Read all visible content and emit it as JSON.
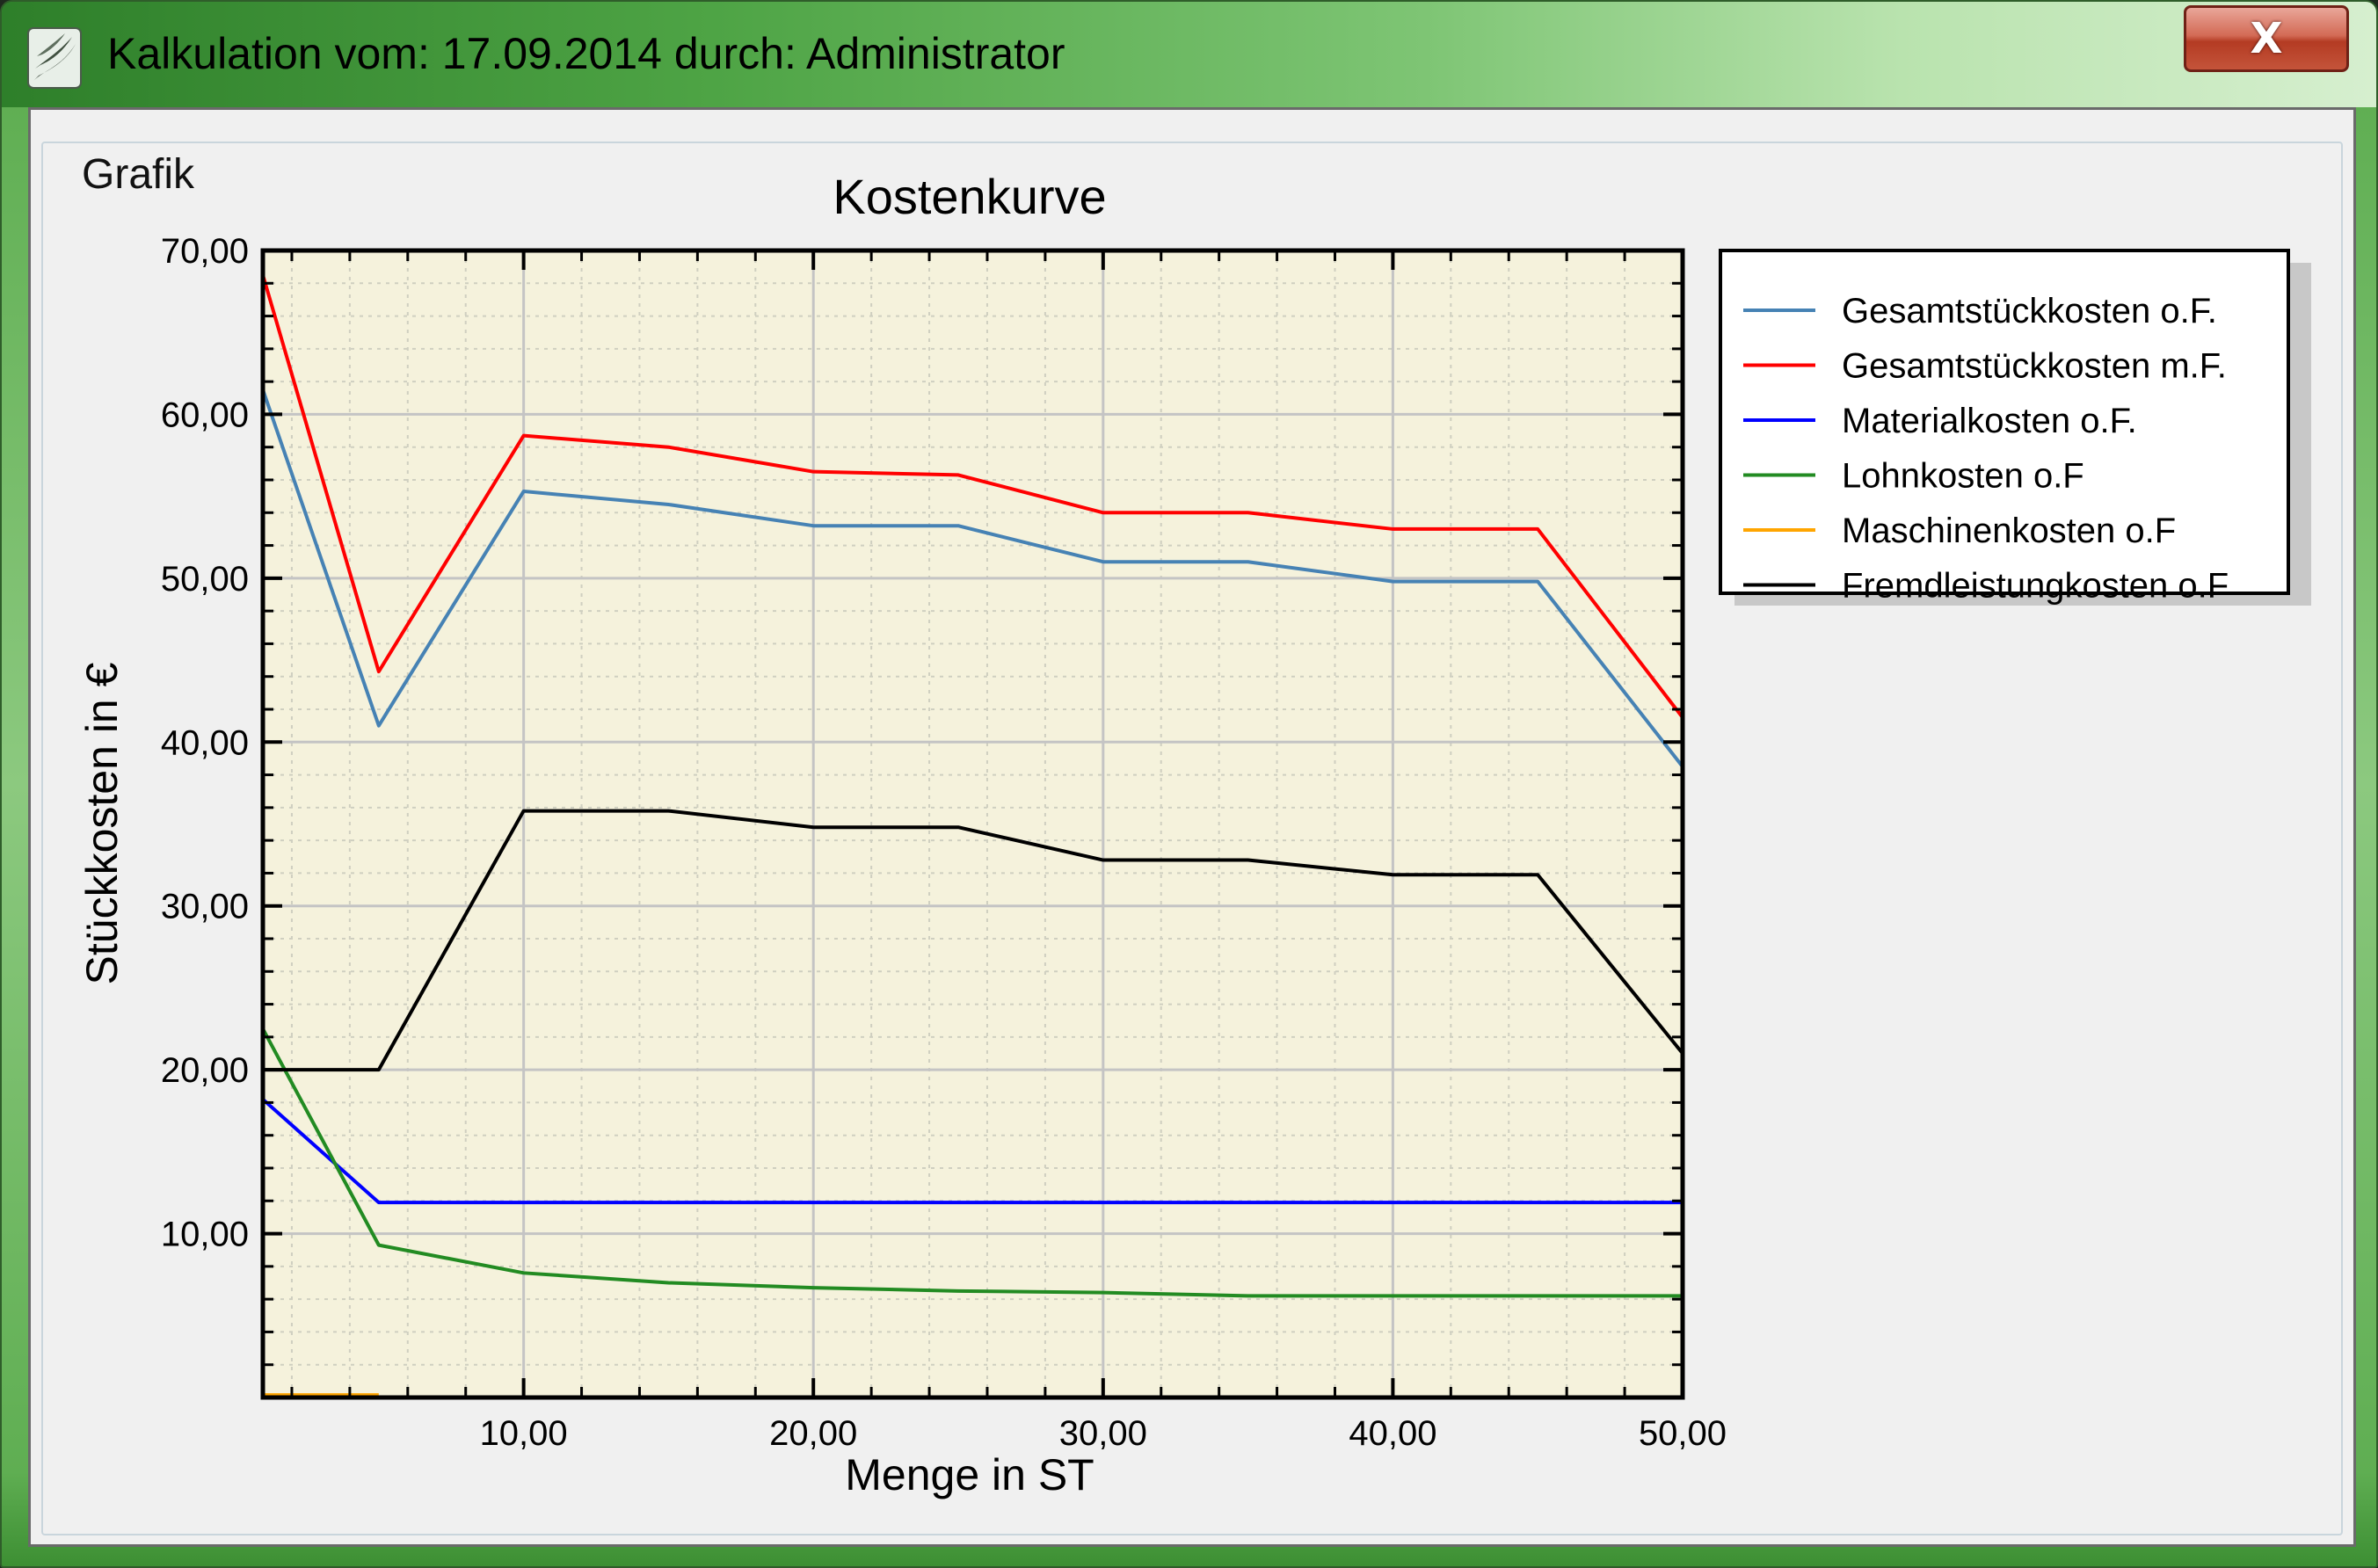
{
  "window": {
    "title": "Kalkulation vom: 17.09.2014 durch: Administrator",
    "close_label": "X",
    "icon": "app-logo-icon"
  },
  "groupbox": {
    "label": "Grafik"
  },
  "chart_data": {
    "type": "line",
    "title": "Kostenkurve",
    "xlabel": "Menge in ST",
    "ylabel": "Stückkosten in €",
    "xlim": [
      1,
      50
    ],
    "ylim": [
      0,
      70
    ],
    "x_ticks": [
      10,
      20,
      30,
      40,
      50
    ],
    "x_tick_labels": [
      "10,00",
      "20,00",
      "30,00",
      "40,00",
      "50,00"
    ],
    "y_ticks": [
      10,
      20,
      30,
      40,
      50,
      60,
      70
    ],
    "y_tick_labels": [
      "10,00",
      "20,00",
      "30,00",
      "40,00",
      "50,00",
      "60,00",
      "70,00"
    ],
    "grid": true,
    "legend_position": "top-right-outside",
    "plot_background": "#f5f2dc",
    "series": [
      {
        "name": "Gesamtstückkosten o.F.",
        "color": "#4682b4",
        "x": [
          1,
          5,
          10,
          15,
          20,
          25,
          30,
          35,
          40,
          45,
          50
        ],
        "y": [
          61.5,
          41,
          55.3,
          54.5,
          53.2,
          53.2,
          51,
          51,
          49.8,
          49.8,
          38.5
        ]
      },
      {
        "name": "Gesamtstückkosten m.F.",
        "color": "#ff0000",
        "x": [
          1,
          5,
          10,
          15,
          20,
          25,
          30,
          35,
          40,
          45,
          50
        ],
        "y": [
          68.5,
          44.3,
          58.7,
          58,
          56.5,
          56.3,
          54,
          54,
          53,
          53,
          41.5
        ]
      },
      {
        "name": "Materialkosten o.F.",
        "color": "#0000ff",
        "x": [
          1,
          5,
          10,
          15,
          20,
          25,
          30,
          35,
          40,
          45,
          50
        ],
        "y": [
          18.2,
          11.9,
          11.9,
          11.9,
          11.9,
          11.9,
          11.9,
          11.9,
          11.9,
          11.9,
          11.9
        ]
      },
      {
        "name": "Lohnkosten o.F",
        "color": "#228b22",
        "x": [
          1,
          5,
          10,
          15,
          20,
          25,
          30,
          35,
          40,
          45,
          50
        ],
        "y": [
          22.5,
          9.3,
          7.6,
          7,
          6.7,
          6.5,
          6.4,
          6.2,
          6.2,
          6.2,
          6.2
        ]
      },
      {
        "name": "Maschinenkosten o.F",
        "color": "#ffa500",
        "x": [
          1,
          5
        ],
        "y": [
          0.1,
          0.1
        ]
      },
      {
        "name": "Fremdleistungkosten o.F",
        "color": "#000000",
        "x": [
          1,
          5,
          10,
          15,
          20,
          25,
          30,
          35,
          40,
          45,
          50
        ],
        "y": [
          20,
          20,
          35.8,
          35.8,
          34.8,
          34.8,
          32.8,
          32.8,
          31.9,
          31.9,
          21
        ]
      }
    ]
  }
}
